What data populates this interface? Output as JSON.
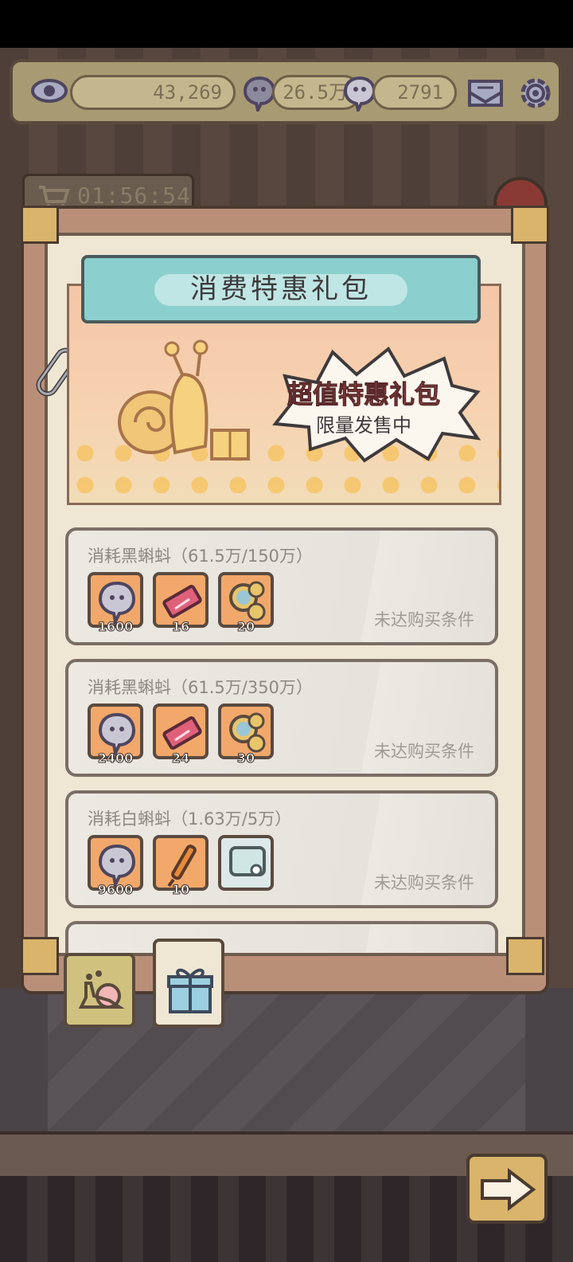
{
  "header": {
    "eye_value": "43,269",
    "tadpole_value": "26.5万",
    "white_tadpole_value": "2791",
    "icons": [
      "eye-icon",
      "black-tadpole-icon",
      "white-tadpole-icon",
      "mail-icon",
      "gear-icon"
    ]
  },
  "timer": {
    "text": "01:56:54",
    "icon": "cart-icon"
  },
  "panel": {
    "title": "消费特惠礼包",
    "banner_title": "超值特惠礼包",
    "banner_subtitle": "限量发售中"
  },
  "offers": [
    {
      "title": "消耗黑蝌蚪（61.5万/150万）",
      "status": "未达购买条件",
      "items": [
        {
          "icon": "tadpole-icon",
          "count": "1600"
        },
        {
          "icon": "ticket-icon",
          "count": "16"
        },
        {
          "icon": "coins-icon",
          "count": "20"
        }
      ]
    },
    {
      "title": "消耗黑蝌蚪（61.5万/350万）",
      "status": "未达购买条件",
      "items": [
        {
          "icon": "tadpole-icon",
          "count": "2400"
        },
        {
          "icon": "ticket-icon",
          "count": "24"
        },
        {
          "icon": "coins-icon",
          "count": "30"
        }
      ]
    },
    {
      "title": "消耗白蝌蚪（1.63万/5万）",
      "status": "未达购买条件",
      "items": [
        {
          "icon": "tadpole-icon",
          "count": "9600"
        },
        {
          "icon": "stick-icon",
          "count": "10"
        },
        {
          "icon": "chat-bubble-icon",
          "count": ""
        }
      ]
    }
  ],
  "tabs": [
    {
      "icon": "snail-icon"
    },
    {
      "icon": "gift-icon"
    }
  ],
  "colors": {
    "accent_teal": "#8ccfcf",
    "frame": "#b98f78",
    "slot_orange": "#f2a86a",
    "card": "#e6e2dc"
  }
}
